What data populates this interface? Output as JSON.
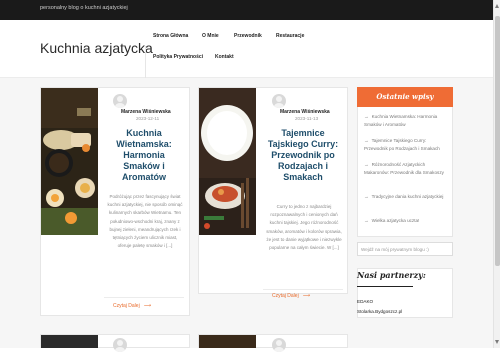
{
  "topbar": {
    "tagline": "personalny blog o kuchni azjatyckiej"
  },
  "site": {
    "title": "Kuchnia azjatycka"
  },
  "nav": {
    "items": [
      "Strona Główna",
      "O Mnie",
      "Przewodnik",
      "Restauracje",
      "Polityka Prywatności",
      "Kontakt"
    ]
  },
  "posts": [
    {
      "author": "Marzena Wiśniewska",
      "date": "2023-12-11",
      "title": "Kuchnia Wietnamska: Harmonia Smaków i Aromatów",
      "excerpt": "Podróżując przez fascynujący świat kuchni azjatyckiej, nie sposób ominąć kulinarnych skarbów Wietnamu. Ten południowo-wschodni kraj, znany z bujnej zieleni, meandrujących rzek i tętniących życiem ulicznik miast, oferuje paletę smaków i [...]",
      "read_more": "Czytaj Dalej"
    },
    {
      "author": "Marzena Wiśniewska",
      "date": "2023-11-13",
      "title": "Tajemnice Tajskiego Curry: Przewodnik po Rodzajach i Smakach",
      "excerpt": "Curry to jedno z najbardziej rozpoznawalnych i cenionych dań kuchni tajskiej. Jego różnorodność smaków, aromatów i kolorów sprawia, że jest to danie wyjątkowe i niezwykle popularne na całym świecie. W [...]",
      "read_more": "Czytaj Dalej"
    }
  ],
  "sidebar": {
    "recent_title": "Ostatnie wpisy",
    "recent": [
      "Kuchnia Wietnamska: Harmonia Smaków i Aromatów",
      "Tajemnice Tajskiego Curry: Przewodnik po Rodzajach i Smakach",
      "Różnorodność Azjatyckich Makaronów: Przewodnik dla Smakoszy",
      "Tradycyjne dania kuchni azjatyckiej",
      "Wielka azjatycka uczta!"
    ],
    "search_placeholder": "Wejdź na mój prywatnym blogu :)",
    "partners_title": "Nasi partnerzy:",
    "partners": [
      "EDAKO",
      "Stolarka.Bydgoszcz.pl"
    ]
  },
  "colors": {
    "accent": "#ef6c35",
    "title_blue": "#1f4e6b",
    "topbar": "#1a1a1a"
  }
}
